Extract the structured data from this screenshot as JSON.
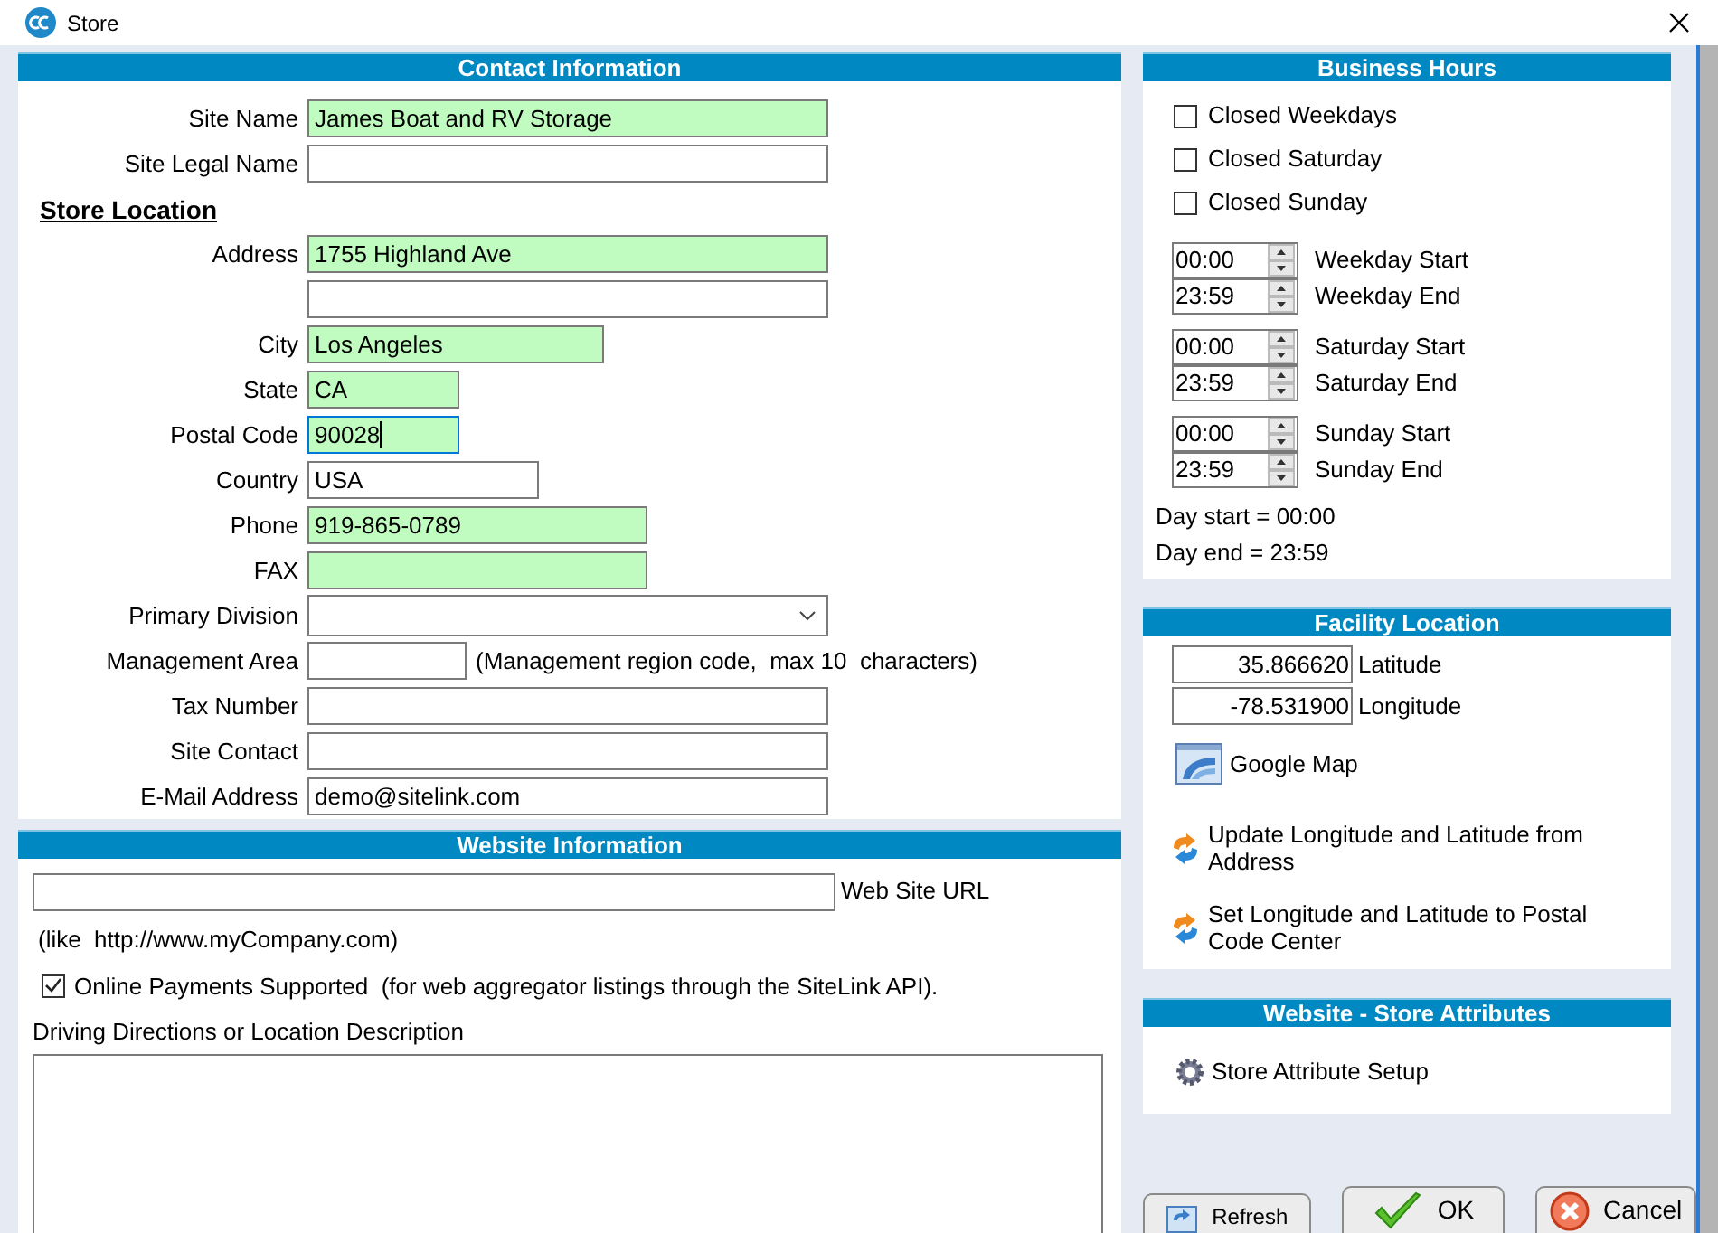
{
  "window": {
    "title": "Store"
  },
  "contact": {
    "title": "Contact Information",
    "rows": [
      {
        "kind": "field",
        "label": "Site Name",
        "value": "James Boat and RV Storage",
        "required": true,
        "focused": false
      },
      {
        "kind": "field",
        "label": "Site Legal Name",
        "required": false,
        "focused": false
      },
      {
        "kind": "heading",
        "label": "Store Location"
      },
      {
        "kind": "field",
        "label": "Address",
        "value": "1755 Highland Ave",
        "required": true,
        "focused": false
      },
      {
        "kind": "field",
        "required": false,
        "focused": false
      },
      {
        "kind": "field",
        "label": "City",
        "value": "Los Angeles",
        "required": true,
        "focused": false
      },
      {
        "kind": "field",
        "label": "State",
        "value": "CA",
        "required": true,
        "focused": false
      },
      {
        "kind": "field",
        "label": "Postal Code",
        "value": "90028",
        "required": true,
        "focused": true
      },
      {
        "kind": "field",
        "label": "Country",
        "value": "USA",
        "required": false,
        "focused": false
      },
      {
        "kind": "field",
        "label": "Phone",
        "value": "919-865-0789",
        "required": true,
        "focused": false
      },
      {
        "kind": "field",
        "label": "FAX",
        "required": true,
        "focused": false
      },
      {
        "kind": "dropdown",
        "label": "Primary Division",
        "required": false,
        "focused": false
      },
      {
        "kind": "field",
        "label": "Management Area",
        "required": false,
        "focused": false,
        "note": "(Management region code,  max 10  characters)"
      },
      {
        "kind": "field",
        "label": "Tax Number",
        "required": false,
        "focused": false
      },
      {
        "kind": "field",
        "label": "Site Contact",
        "required": false,
        "focused": false
      },
      {
        "kind": "field",
        "label": "E-Mail Address",
        "value": "demo@sitelink.com",
        "required": false,
        "focused": false
      }
    ]
  },
  "website": {
    "title": "Website Information",
    "url_label": "Web Site URL",
    "url_hint": "(like  http://www.myCompany.com)",
    "online_payments": {
      "label": "Online Payments Supported  (for web aggregator listings through the SiteLink API).",
      "checked": true
    },
    "directions_label": "Driving Directions or Location Description"
  },
  "business_hours": {
    "title": "Business Hours",
    "closed": [
      {
        "label": "Closed Weekdays",
        "checked": false
      },
      {
        "label": "Closed Saturday",
        "checked": false
      },
      {
        "label": "Closed Sunday",
        "checked": false
      }
    ],
    "schedules": [
      {
        "start": {
          "value": "00:00",
          "label": "Weekday Start"
        },
        "end": {
          "value": "23:59",
          "label": "Weekday End"
        }
      },
      {
        "start": {
          "value": "00:00",
          "label": "Saturday Start"
        },
        "end": {
          "value": "23:59",
          "label": "Saturday End"
        }
      },
      {
        "start": {
          "value": "00:00",
          "label": "Sunday Start"
        },
        "end": {
          "value": "23:59",
          "label": "Sunday End"
        }
      }
    ],
    "day_start": "Day start = 00:00",
    "day_end": "Day end = 23:59"
  },
  "facility": {
    "title": "Facility Location",
    "coordinates": [
      {
        "value": "35.866620",
        "label": "Latitude"
      },
      {
        "value": "-78.531900",
        "label": "Longitude"
      }
    ],
    "links": [
      {
        "kind": "map",
        "label": "Google Map"
      },
      {
        "kind": "sync",
        "label": "Update Longitude and Latitude from Address"
      },
      {
        "kind": "sync",
        "label": "Set Longitude and Latitude to Postal Code Center"
      }
    ]
  },
  "attributes": {
    "title": "Website - Store Attributes",
    "links": [
      {
        "kind": "gear",
        "label": "Store Attribute Setup"
      }
    ]
  },
  "buttons": [
    {
      "kind": "refresh",
      "label": "Refresh"
    },
    {
      "kind": "ok",
      "label": "OK"
    },
    {
      "kind": "cancel",
      "label": "Cancel"
    }
  ]
}
